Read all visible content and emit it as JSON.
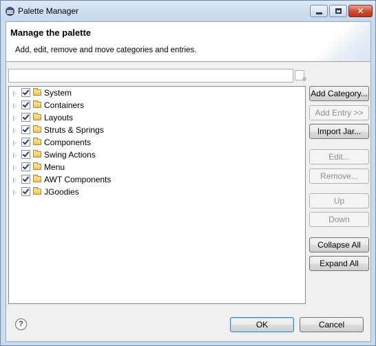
{
  "window": {
    "title": "Palette Manager",
    "close_glyph": "✕"
  },
  "header": {
    "title": "Manage the palette",
    "description": "Add, edit, remove and move categories and entries."
  },
  "filter": {
    "value": "",
    "placeholder": ""
  },
  "tree": {
    "items": [
      {
        "label": "System",
        "checked": true
      },
      {
        "label": "Containers",
        "checked": true
      },
      {
        "label": "Layouts",
        "checked": true
      },
      {
        "label": "Struts & Springs",
        "checked": true
      },
      {
        "label": "Components",
        "checked": true
      },
      {
        "label": "Swing Actions",
        "checked": true
      },
      {
        "label": "Menu",
        "checked": true
      },
      {
        "label": "AWT Components",
        "checked": true
      },
      {
        "label": "JGoodies",
        "checked": true
      }
    ]
  },
  "buttons": {
    "add_category": "Add Category...",
    "add_entry": "Add Entry >>",
    "import_jar": "Import Jar...",
    "edit": "Edit...",
    "remove": "Remove...",
    "up": "Up",
    "down": "Down",
    "collapse_all": "Collapse All",
    "expand_all": "Expand All",
    "ok": "OK",
    "cancel": "Cancel"
  },
  "help": {
    "glyph": "?"
  },
  "colors": {
    "window_frame": "#c9dbef",
    "close_button": "#c94b32",
    "dialog_background": "#f0f0f0"
  }
}
